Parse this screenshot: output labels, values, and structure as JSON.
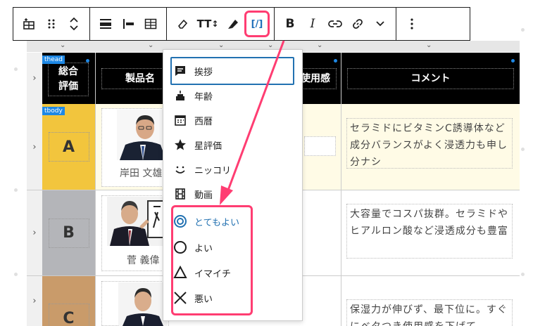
{
  "toolbar": {
    "groups": [
      [
        "table-icon",
        "drag-handle-icon",
        "move-updown-icon"
      ],
      [
        "align-full-icon",
        "align-left-icon",
        "table-edit-icon"
      ],
      [
        "eraser-icon",
        "text-size-icon",
        "highlighter-icon",
        "inline-code-icon"
      ],
      [
        "bold-icon",
        "italic-icon",
        "link-icon",
        "link-alt-icon",
        "chevron-down-icon"
      ],
      [
        "more-vertical-icon"
      ]
    ],
    "bold_label": "B",
    "italic_label": "I",
    "text_size_label": "TT",
    "code_label": "[/]"
  },
  "table": {
    "tags": {
      "thead": "thead",
      "tbody": "tbody"
    },
    "headers": [
      "総合\n評価",
      "製品名",
      "使用感",
      "コメント"
    ],
    "rows": [
      {
        "grade": "A",
        "grade_color": "#f2c53d",
        "product": "岸田 文雄",
        "comment": "セラミドにビタミンC誘導体など成分バランスがよく浸透力も申し分ナシ"
      },
      {
        "grade": "B",
        "grade_color": "#b4b5b9",
        "product": "菅 義偉",
        "comment": "大容量でコスパ抜群。セラミドやヒアルロン酸など浸透成分も豊富"
      },
      {
        "grade": "C",
        "grade_color": "#c99b6a",
        "product": "",
        "comment": "保湿力が伸びず、最下位に。すぐにベタつき使用感を下げて"
      }
    ]
  },
  "menu": {
    "items": [
      {
        "icon": "comment-icon",
        "label": "挨拶"
      },
      {
        "icon": "cake-icon",
        "label": "年齢"
      },
      {
        "icon": "calendar-icon",
        "label": "西暦"
      },
      {
        "icon": "star-icon",
        "label": "星評価"
      },
      {
        "icon": "smile-icon",
        "label": "ニッコリ"
      },
      {
        "icon": "film-icon",
        "label": "動画"
      },
      {
        "icon": "double-circle-icon",
        "label": "とてもよい"
      },
      {
        "icon": "circle-icon",
        "label": "よい"
      },
      {
        "icon": "triangle-icon",
        "label": "イマイチ"
      },
      {
        "icon": "cross-icon",
        "label": "悪い"
      }
    ]
  },
  "colors": {
    "accent": "#ff3d72",
    "selected": "#2271b1",
    "tag": "#1e88e5"
  }
}
